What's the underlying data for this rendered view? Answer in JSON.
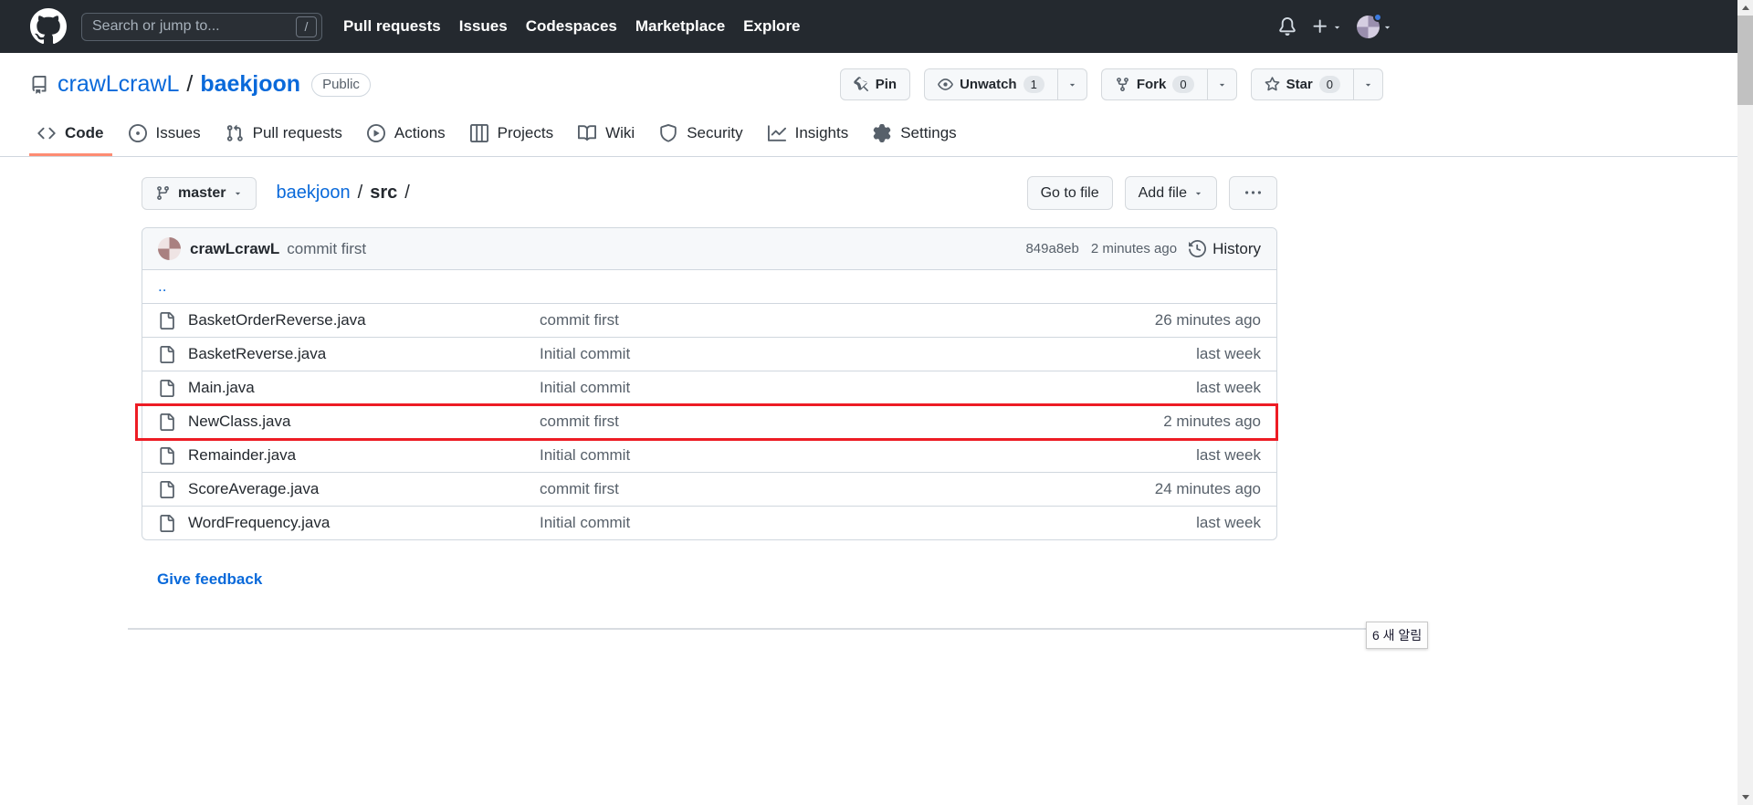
{
  "annotation": {
    "highlighted_file": "NewClass.java",
    "highlight_color": "#ed1c24"
  },
  "header": {
    "search": {
      "placeholder": "Search or jump to...",
      "hotkey": "/"
    },
    "nav": [
      "Pull requests",
      "Issues",
      "Codespaces",
      "Marketplace",
      "Explore"
    ]
  },
  "repo": {
    "owner": "crawLcrawL",
    "separator": "/",
    "name": "baekjoon",
    "visibility": "Public",
    "pin": "Pin",
    "watch": "Unwatch",
    "watch_count": "1",
    "fork": "Fork",
    "fork_count": "0",
    "star": "Star",
    "star_count": "0"
  },
  "tabs": [
    "Code",
    "Issues",
    "Pull requests",
    "Actions",
    "Projects",
    "Wiki",
    "Security",
    "Insights",
    "Settings"
  ],
  "file_nav": {
    "branch": "master",
    "breadcrumb_repo": "baekjoon",
    "separator": "/",
    "breadcrumb_path": "src",
    "go_to_file": "Go to file",
    "add_file": "Add file"
  },
  "commit_bar": {
    "author": "crawLcrawL",
    "message": "commit first",
    "hash": "849a8eb",
    "age": "2 minutes ago",
    "history": "History"
  },
  "file_list": {
    "up": "..",
    "files": [
      {
        "name": "BasketOrderReverse.java",
        "message": "commit first",
        "age": "26 minutes ago"
      },
      {
        "name": "BasketReverse.java",
        "message": "Initial commit",
        "age": "last week"
      },
      {
        "name": "Main.java",
        "message": "Initial commit",
        "age": "last week"
      },
      {
        "name": "NewClass.java",
        "message": "commit first",
        "age": "2 minutes ago"
      },
      {
        "name": "Remainder.java",
        "message": "Initial commit",
        "age": "last week"
      },
      {
        "name": "ScoreAverage.java",
        "message": "commit first",
        "age": "24 minutes ago"
      },
      {
        "name": "WordFrequency.java",
        "message": "Initial commit",
        "age": "last week"
      }
    ]
  },
  "footer": {
    "give_feedback": "Give feedback"
  },
  "system": {
    "toast": "6 새 알림"
  }
}
